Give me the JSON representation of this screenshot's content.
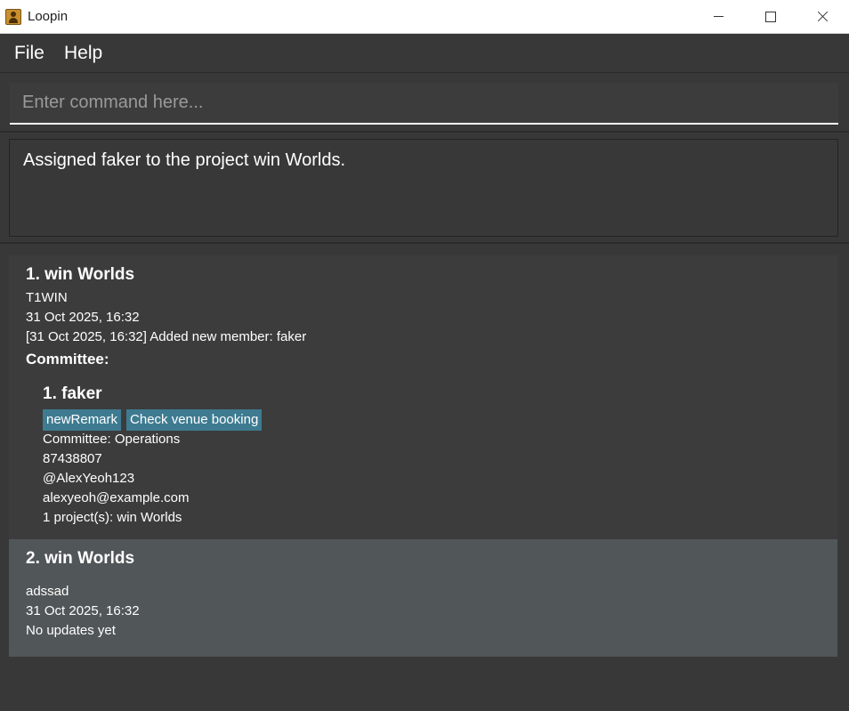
{
  "window": {
    "title": "Loopin"
  },
  "menu": {
    "file": "File",
    "help": "Help"
  },
  "command": {
    "placeholder": "Enter command here...",
    "value": ""
  },
  "result": {
    "text": "Assigned faker to the project win Worlds."
  },
  "projects": [
    {
      "title": "1. win Worlds",
      "code": "T1WIN",
      "datetime": "31 Oct 2025, 16:32",
      "update": "[31 Oct 2025, 16:32] Added new member: faker",
      "committee_label": "Committee:",
      "members": [
        {
          "title": "1. faker",
          "tags": [
            "newRemark",
            "Check venue booking"
          ],
          "committee": "Committee: Operations",
          "phone": "87438807",
          "handle": "@AlexYeoh123",
          "email": "alexyeoh@example.com",
          "projects": "1 project(s): win Worlds"
        }
      ]
    },
    {
      "title": "2. win Worlds",
      "code": "adssad",
      "datetime": "31 Oct 2025, 16:32",
      "update": "No updates yet"
    }
  ]
}
